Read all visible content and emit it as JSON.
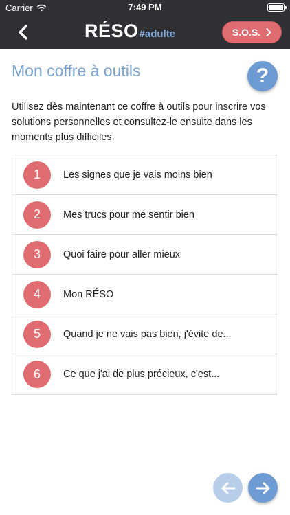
{
  "status_bar": {
    "carrier": "Carrier",
    "time": "7:49 PM"
  },
  "nav": {
    "logo_main": "RÉSO",
    "logo_tag": "#adulte",
    "sos_label": "S.O.S."
  },
  "page": {
    "title": "Mon coffre à outils",
    "help_label": "?",
    "intro": "Utilisez dès maintenant ce coffre à outils pour inscrire vos solutions personnelles et consultez-le ensuite dans les moments plus difficiles."
  },
  "tools": [
    {
      "number": "1",
      "label": "Les signes que je vais moins bien"
    },
    {
      "number": "2",
      "label": "Mes trucs pour me sentir bien"
    },
    {
      "number": "3",
      "label": "Quoi faire pour aller mieux"
    },
    {
      "number": "4",
      "label": "Mon RÉSO"
    },
    {
      "number": "5",
      "label": "Quand je ne vais pas bien, j'évite de..."
    },
    {
      "number": "6",
      "label": "Ce que j'ai de plus précieux, c'est..."
    }
  ],
  "colors": {
    "header_bg": "#2f3033",
    "accent_red": "#e06c72",
    "accent_blue": "#6e9bd4",
    "title_blue": "#7aa2cf"
  },
  "icons": {
    "back": "chevron-left-icon",
    "sos_arrow": "chevron-right-icon",
    "help": "question-mark-icon",
    "prev": "arrow-left-icon",
    "next": "arrow-right-icon"
  }
}
